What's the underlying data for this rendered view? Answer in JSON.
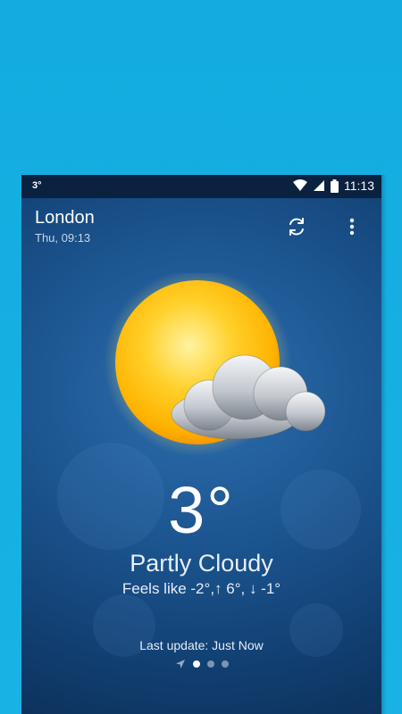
{
  "status_bar": {
    "left_indicator": "3°",
    "time": "11:13",
    "icons": [
      "wifi-icon",
      "signal-icon",
      "battery-icon"
    ]
  },
  "location": {
    "city": "London",
    "datetime": "Thu, 09:13"
  },
  "actions": {
    "refresh_icon": "refresh-icon",
    "menu_icon": "more-vert-icon"
  },
  "weather": {
    "icon": "partly-cloudy-icon",
    "temperature": "3°",
    "condition": "Partly Cloudy",
    "feels_like": "Feels like -2°,↑ 6°, ↓ -1°",
    "last_update": "Last update: Just Now"
  },
  "pager": {
    "pages": 4,
    "active_index": 1,
    "first_icon": "location-arrow-icon"
  },
  "colors": {
    "outer_background": "#16aee0",
    "panel_background": "#1c5590",
    "status_bar": "#0a2140",
    "sun": "#ffc21a",
    "text": "#ffffff"
  }
}
